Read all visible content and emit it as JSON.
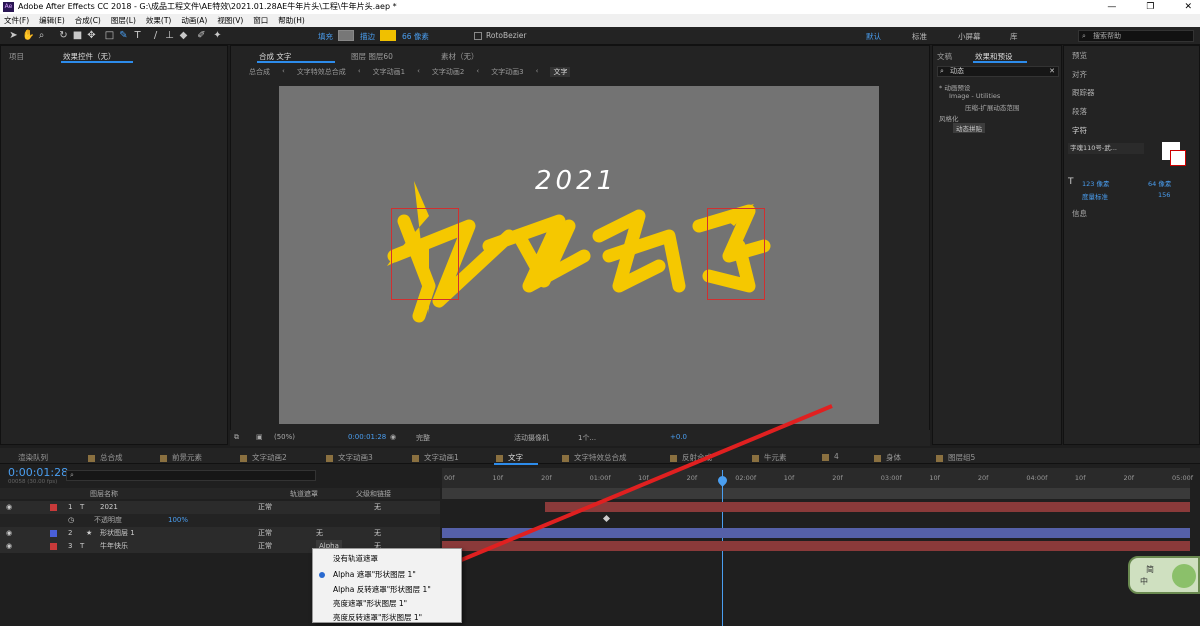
{
  "app": {
    "title": "Adobe After Effects CC 2018 - G:\\成品工程文件\\AE特效\\2021.01.28AE牛年片头\\工程\\牛年片头.aep *",
    "logo": "Ae"
  },
  "window_controls": [
    "—",
    "❐",
    "✕"
  ],
  "menu": [
    "文件(F)",
    "编辑(E)",
    "合成(C)",
    "图层(L)",
    "效果(T)",
    "动画(A)",
    "视图(V)",
    "窗口",
    "帮助(H)"
  ],
  "toolbar": {
    "fill_label": "填充",
    "stroke_label": "描边",
    "stroke_value": "66 像素",
    "rotobezier": "RotoBezier",
    "workspaces": [
      "默认",
      "标准",
      "小屏幕",
      "库"
    ],
    "search_placeholder": "搜索帮助"
  },
  "left_panel": {
    "tab_project": "项目",
    "tab_effects": "效果控件（无）"
  },
  "viewer": {
    "tabs": [
      "合成 文字",
      "图层 图层60",
      "素材（无）"
    ],
    "breadcrumbs": [
      "总合成",
      "文字特效总合成",
      "文字动画1",
      "文字动画2",
      "文字动画3",
      "文字"
    ],
    "year_text": "2021",
    "zoom": "(50%)",
    "timecode": "0:00:01:28",
    "quality": "完整",
    "camera": "活动摄像机",
    "views": "1个...",
    "exposure": "+0.0"
  },
  "effects_panel": {
    "tab_text": "文​稿",
    "tab_effects": "效果和预设",
    "search_value": "动态",
    "tree": [
      "* 动画预设",
      "Image - Utilities",
      "压缩-扩展动态范围",
      "风格化",
      "动态拼贴"
    ]
  },
  "far_right": {
    "items": [
      "预览",
      "对齐",
      "跟踪器",
      "段落",
      "字符",
      "信息"
    ],
    "font_name": "字魂110号-武...",
    "font_size": "123 像素",
    "leading": "64 像素",
    "tracking_label": "度量标准",
    "tracking_value": "156"
  },
  "timeline": {
    "tabs": [
      {
        "label": "渲染队列",
        "color": ""
      },
      {
        "label": "总合成",
        "color": "#8a7040"
      },
      {
        "label": "前景元素",
        "color": "#8a7040"
      },
      {
        "label": "文字动画2",
        "color": "#8a7040"
      },
      {
        "label": "文字动画3",
        "color": "#8a7040"
      },
      {
        "label": "文字动画1",
        "color": "#8a7040"
      },
      {
        "label": "文字",
        "color": "#8a7040"
      },
      {
        "label": "文字特效总合成",
        "color": "#8a7040"
      },
      {
        "label": "反射合成",
        "color": "#8a7040"
      },
      {
        "label": "牛元素",
        "color": "#8a7040"
      },
      {
        "label": "4",
        "color": "#8a7040"
      },
      {
        "label": "身体",
        "color": "#8a7040"
      },
      {
        "label": "图层组5",
        "color": "#8a7040"
      }
    ],
    "timecode": "0:00:01:28",
    "frame_info": "00058 (30.00 fps)",
    "col_name": "图层名称",
    "col_mode": "轨道遮罩",
    "col_parent": "父级和链接",
    "ruler": [
      "00f",
      "10f",
      "20f",
      "01:00f",
      "10f",
      "20f",
      "02:00f",
      "10f",
      "20f",
      "03:00f",
      "10f",
      "20f",
      "04:00f",
      "10f",
      "20f",
      "05:00f"
    ],
    "layers": [
      {
        "num": "1",
        "name": "2021",
        "mode": "正常",
        "trk": "",
        "parent": "无",
        "color": "#c83a3a",
        "type": "T"
      },
      {
        "num": "",
        "name": "不透明度",
        "mode": "",
        "trk": "",
        "parent": "",
        "color": "",
        "type": "",
        "value": "100%"
      },
      {
        "num": "2",
        "name": "形状图层 1",
        "mode": "正常",
        "trk": "无",
        "parent": "无",
        "color": "#4a5fd8",
        "type": "★"
      },
      {
        "num": "3",
        "name": "牛年快乐",
        "mode": "正常",
        "trk": "Alpha",
        "parent": "无",
        "color": "#c83a3a",
        "type": "T"
      }
    ]
  },
  "context_menu": {
    "items": [
      "没有轨道遮罩",
      "Alpha 遮罩\"形状图层 1\"",
      "Alpha 反转遮罩\"形状图层 1\"",
      "亮度遮罩\"形状图层 1\"",
      "亮度反转遮罩\"形状图层 1\""
    ],
    "selected_index": 1
  },
  "badge": {
    "line1": "简",
    "line2": "中"
  }
}
